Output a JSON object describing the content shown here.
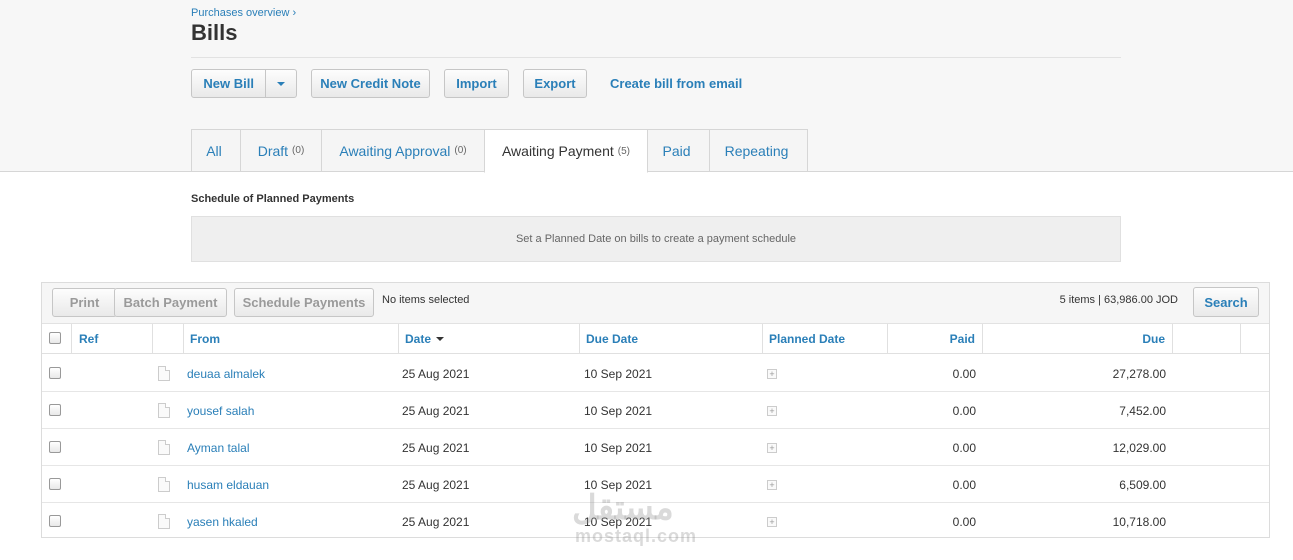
{
  "breadcrumb": "Purchases overview ›",
  "title": "Bills",
  "actions": {
    "new_bill": "New Bill",
    "new_credit_note": "New Credit Note",
    "import": "Import",
    "export": "Export",
    "create_from_email": "Create bill from email"
  },
  "tabs": [
    {
      "label": "All",
      "count": ""
    },
    {
      "label": "Draft",
      "count": "(0)"
    },
    {
      "label": "Awaiting Approval",
      "count": "(0)"
    },
    {
      "label": "Awaiting Payment",
      "count": "(5)"
    },
    {
      "label": "Paid",
      "count": ""
    },
    {
      "label": "Repeating",
      "count": ""
    }
  ],
  "active_tab": "Awaiting Payment",
  "schedule": {
    "title": "Schedule of Planned Payments",
    "empty_message": "Set a Planned Date on bills to create a payment schedule"
  },
  "toolbar": {
    "print": "Print",
    "batch_payment": "Batch Payment",
    "schedule_payments": "Schedule Payments",
    "selection_status": "No items selected",
    "summary": "5 items | 63,986.00 JOD",
    "search": "Search"
  },
  "columns": {
    "ref": "Ref",
    "from": "From",
    "date": "Date",
    "due_date": "Due Date",
    "planned_date": "Planned Date",
    "paid": "Paid",
    "due": "Due"
  },
  "rows": [
    {
      "from": "deuaa almalek",
      "date": "25 Aug 2021",
      "due_date": "10 Sep 2021",
      "paid": "0.00",
      "due": "27,278.00"
    },
    {
      "from": "yousef salah",
      "date": "25 Aug 2021",
      "due_date": "10 Sep 2021",
      "paid": "0.00",
      "due": "7,452.00"
    },
    {
      "from": "Ayman talal",
      "date": "25 Aug 2021",
      "due_date": "10 Sep 2021",
      "paid": "0.00",
      "due": "12,029.00"
    },
    {
      "from": "husam eldauan",
      "date": "25 Aug 2021",
      "due_date": "10 Sep 2021",
      "paid": "0.00",
      "due": "6,509.00"
    },
    {
      "from": "yasen hkaled",
      "date": "25 Aug 2021",
      "due_date": "10 Sep 2021",
      "paid": "0.00",
      "due": "10,718.00"
    }
  ],
  "watermark": {
    "arabic": "مستقل",
    "latin": "mostaql.com"
  },
  "colors": {
    "link": "#2a7fb8",
    "text": "#333333",
    "border": "#d6d6d6"
  }
}
